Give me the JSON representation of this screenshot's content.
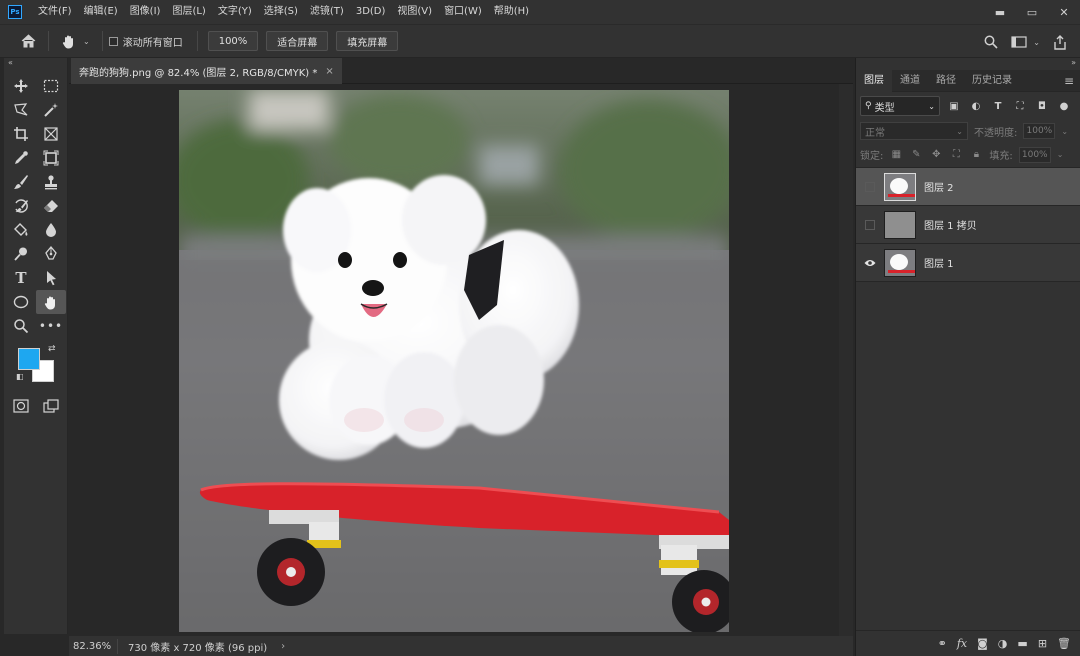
{
  "app": {
    "logo": "Ps"
  },
  "menu": {
    "items": [
      "文件(F)",
      "编辑(E)",
      "图像(I)",
      "图层(L)",
      "文字(Y)",
      "选择(S)",
      "滤镜(T)",
      "3D(D)",
      "视图(V)",
      "窗口(W)",
      "帮助(H)"
    ]
  },
  "window_controls": {
    "minimize": "▬",
    "maximize": "▭",
    "close": "✕"
  },
  "options": {
    "scroll_all_label": "滚动所有窗口",
    "zoom_value": "100%",
    "fit_screen_label": "适合屏幕",
    "fill_screen_label": "填充屏幕"
  },
  "document": {
    "tab_title": "奔跑的狗狗.png @ 82.4% (图层 2, RGB/8/CMYK) *",
    "close_glyph": "×"
  },
  "status": {
    "zoom": "82.36%",
    "doc_info": "730 像素 x 720 像素 (96 ppi)",
    "arrow": "›"
  },
  "colors": {
    "foreground": "#1ea7f0",
    "background": "#ffffff",
    "skateboard": "#d8222a"
  },
  "panels": {
    "tabs": [
      "图层",
      "通道",
      "路径",
      "历史记录"
    ],
    "active_tab": "图层",
    "filter_kind": "类型",
    "blend_mode": "正常",
    "opacity_label": "不透明度:",
    "opacity_value": "100%",
    "lock_label": "锁定:",
    "fill_label": "填充:",
    "fill_value": "100%"
  },
  "layers": [
    {
      "name": "图层 2",
      "visible": false,
      "selected": true
    },
    {
      "name": "图层 1 拷贝",
      "visible": false,
      "selected": false
    },
    {
      "name": "图层 1",
      "visible": true,
      "selected": false
    }
  ],
  "icons": {
    "home": "home-icon",
    "hand": "hand-icon",
    "search": "search-icon",
    "share": "share-icon"
  }
}
